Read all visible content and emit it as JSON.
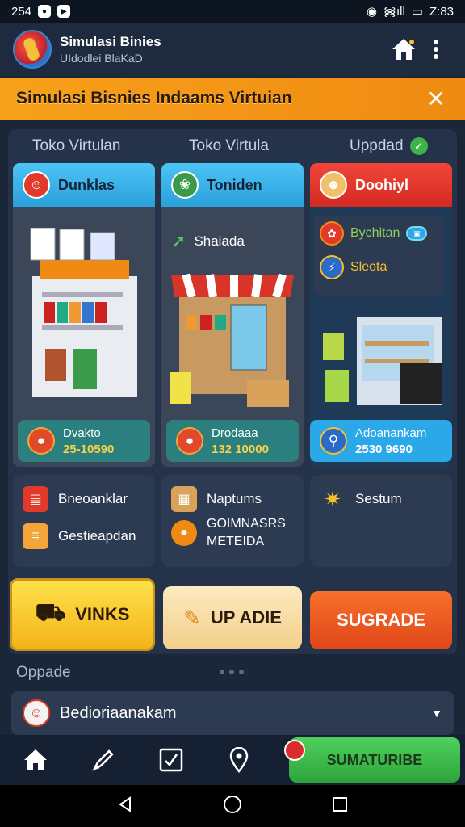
{
  "status_bar": {
    "time_left": "254",
    "time_right": "Z:83"
  },
  "app_bar": {
    "title": "Simulasi Binies",
    "subtitle": "UIdodlei BlaKaD"
  },
  "banner": {
    "text": "Simulasi Bisnies Indaams Virtuian",
    "close": "✕"
  },
  "columns": {
    "col1": "Toko Virtulan",
    "col2": "Toko Virtula",
    "col3": "Uppdad"
  },
  "cards": [
    {
      "header": "Dunklas",
      "footer_name": "Dvakto",
      "footer_value": "25-10590"
    },
    {
      "header": "Toniden",
      "sub_label": "Shaiada",
      "footer_name": "Drodaaa",
      "footer_value": "132 10000"
    },
    {
      "header": "Doohiyl",
      "row1": "Bychitan",
      "row2": "Sleota",
      "footer_name": "Adoanankam",
      "footer_value": "2530 9690"
    }
  ],
  "mini_cards": {
    "left": [
      "Bneoanklar",
      "Gestieapdan"
    ],
    "middle": [
      "Naptums",
      "GOIMNASRS",
      "METEIDA"
    ],
    "right": [
      "Sestum"
    ]
  },
  "buttons": {
    "b1": "VINKS",
    "b2": "UP ADIE",
    "b3": "SUGRADE"
  },
  "section": {
    "label": "Oppade"
  },
  "dropdown": {
    "value": "Bedioriaanakam"
  },
  "bottom_nav": {
    "subscribe": "SUMATURIBE"
  },
  "colors": {
    "banner": "#f7a11a",
    "accent_blue": "#2aa8e8",
    "accent_red": "#e23a2a",
    "button_yellow": "#f6c22a",
    "button_orange": "#ef5a1e",
    "button_green": "#3cbf4a"
  }
}
